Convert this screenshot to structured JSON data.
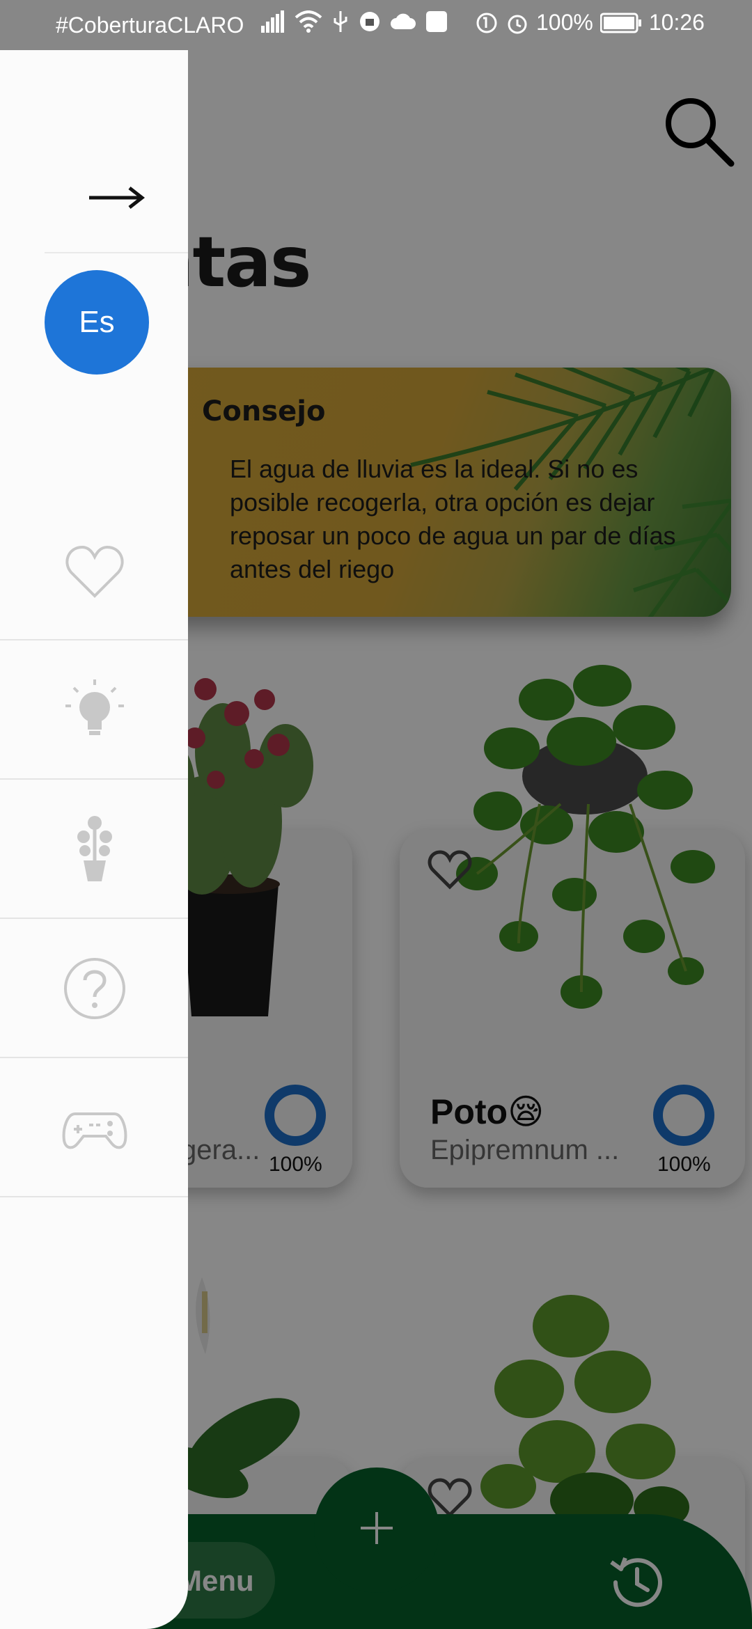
{
  "status_bar": {
    "carrier": "#CoberturaCLARO",
    "battery": "100%",
    "time": "10:26"
  },
  "header": {
    "title": "plantas",
    "search_icon": "search-icon"
  },
  "tip": {
    "title": "Consejo",
    "text": "El agua de lluvia es la ideal. Si no es posible recogerla, otra opción es dejar reposar un poco de agua un par de días antes del riego"
  },
  "plants": [
    {
      "name": "",
      "scientific": "gera...",
      "water_level": "100%",
      "favorite_icon": "heart-outline-icon"
    },
    {
      "name": "Poto😪",
      "scientific": "Epipremnum ...",
      "water_level": "100%",
      "favorite_icon": "heart-outline-icon"
    }
  ],
  "bottom_nav": {
    "menu_label": "Menu",
    "add_icon": "plus-icon",
    "history_icon": "history-icon"
  },
  "drawer": {
    "close_icon": "arrow-right-icon",
    "language": "Es",
    "items": [
      {
        "icon": "heart-icon"
      },
      {
        "icon": "lightbulb-icon"
      },
      {
        "icon": "plant-icon"
      },
      {
        "icon": "help-icon"
      },
      {
        "icon": "gamepad-icon"
      }
    ]
  },
  "colors": {
    "accent_blue": "#1e75d8",
    "bar_green": "#06602a",
    "drawer_bg": "#fbfbfb",
    "icon_grey": "#c8c8c8"
  }
}
